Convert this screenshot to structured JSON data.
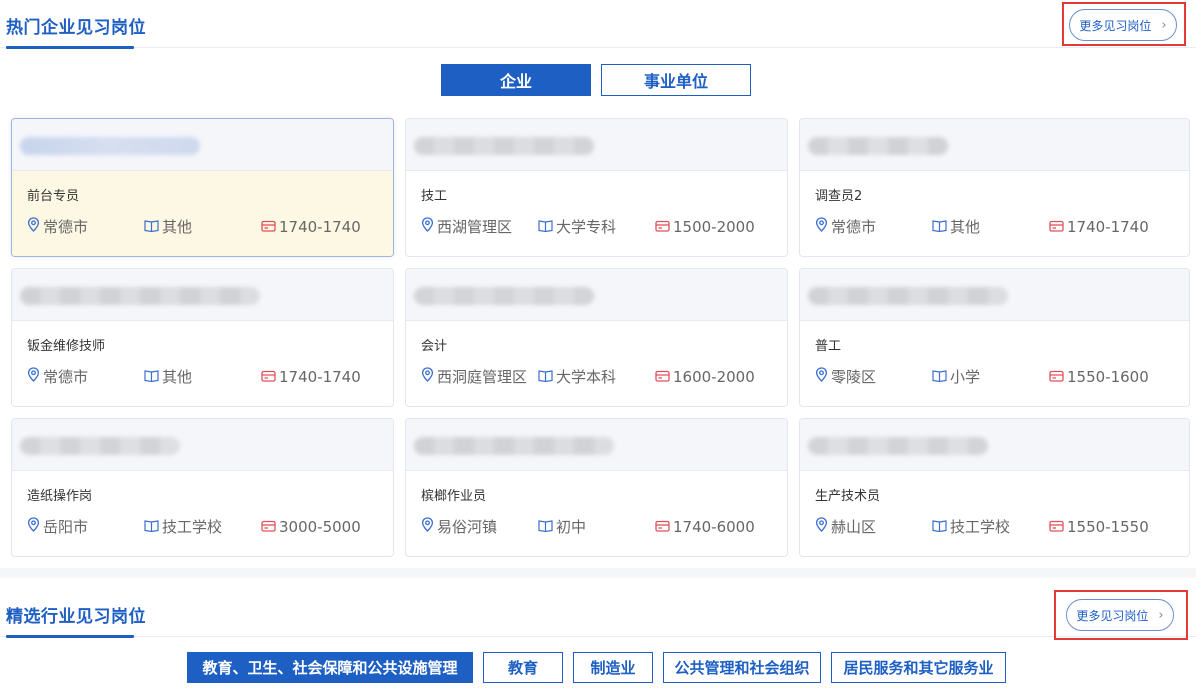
{
  "section1": {
    "title": "热门企业见习岗位",
    "more_label": "更多见习岗位",
    "more_chevron": "›"
  },
  "tabs": [
    {
      "label": "企业",
      "active": true
    },
    {
      "label": "事业单位",
      "active": false
    }
  ],
  "cards": [
    {
      "title": "前台专员",
      "location": "常德市",
      "education": "其他",
      "salary": "1740-1740",
      "highlight": true
    },
    {
      "title": "技工",
      "location": "西湖管理区",
      "education": "大学专科",
      "salary": "1500-2000"
    },
    {
      "title": "调查员2",
      "location": "常德市",
      "education": "其他",
      "salary": "1740-1740"
    },
    {
      "title": "钣金维修技师",
      "location": "常德市",
      "education": "其他",
      "salary": "1740-1740"
    },
    {
      "title": "会计",
      "location": "西洞庭管理区",
      "education": "大学本科",
      "salary": "1600-2000"
    },
    {
      "title": "普工",
      "location": "零陵区",
      "education": "小学",
      "salary": "1550-1600"
    },
    {
      "title": "造纸操作岗",
      "location": "岳阳市",
      "education": "技工学校",
      "salary": "3000-5000"
    },
    {
      "title": "槟榔作业员",
      "location": "易俗河镇",
      "education": "初中",
      "salary": "1740-6000"
    },
    {
      "title": "生产技术员",
      "location": "赫山区",
      "education": "技工学校",
      "salary": "1550-1550"
    }
  ],
  "section2": {
    "title": "精选行业见习岗位",
    "more_label": "更多见习岗位",
    "more_chevron": "›"
  },
  "industries": [
    {
      "label": "教育、卫生、社会保障和公共设施管理",
      "active": true
    },
    {
      "label": "教育",
      "active": false
    },
    {
      "label": "制造业",
      "active": false
    },
    {
      "label": "公共管理和社会组织",
      "active": false
    },
    {
      "label": "居民服务和其它服务业",
      "active": false
    }
  ],
  "icons": {
    "location": "location-pin-icon",
    "education": "book-icon",
    "salary": "money-card-icon"
  },
  "colors": {
    "accent": "#1e5fc4",
    "highlight_box": "#e53935",
    "salary_icon": "#e0505a",
    "highlight_card": "#fdf8e4"
  }
}
